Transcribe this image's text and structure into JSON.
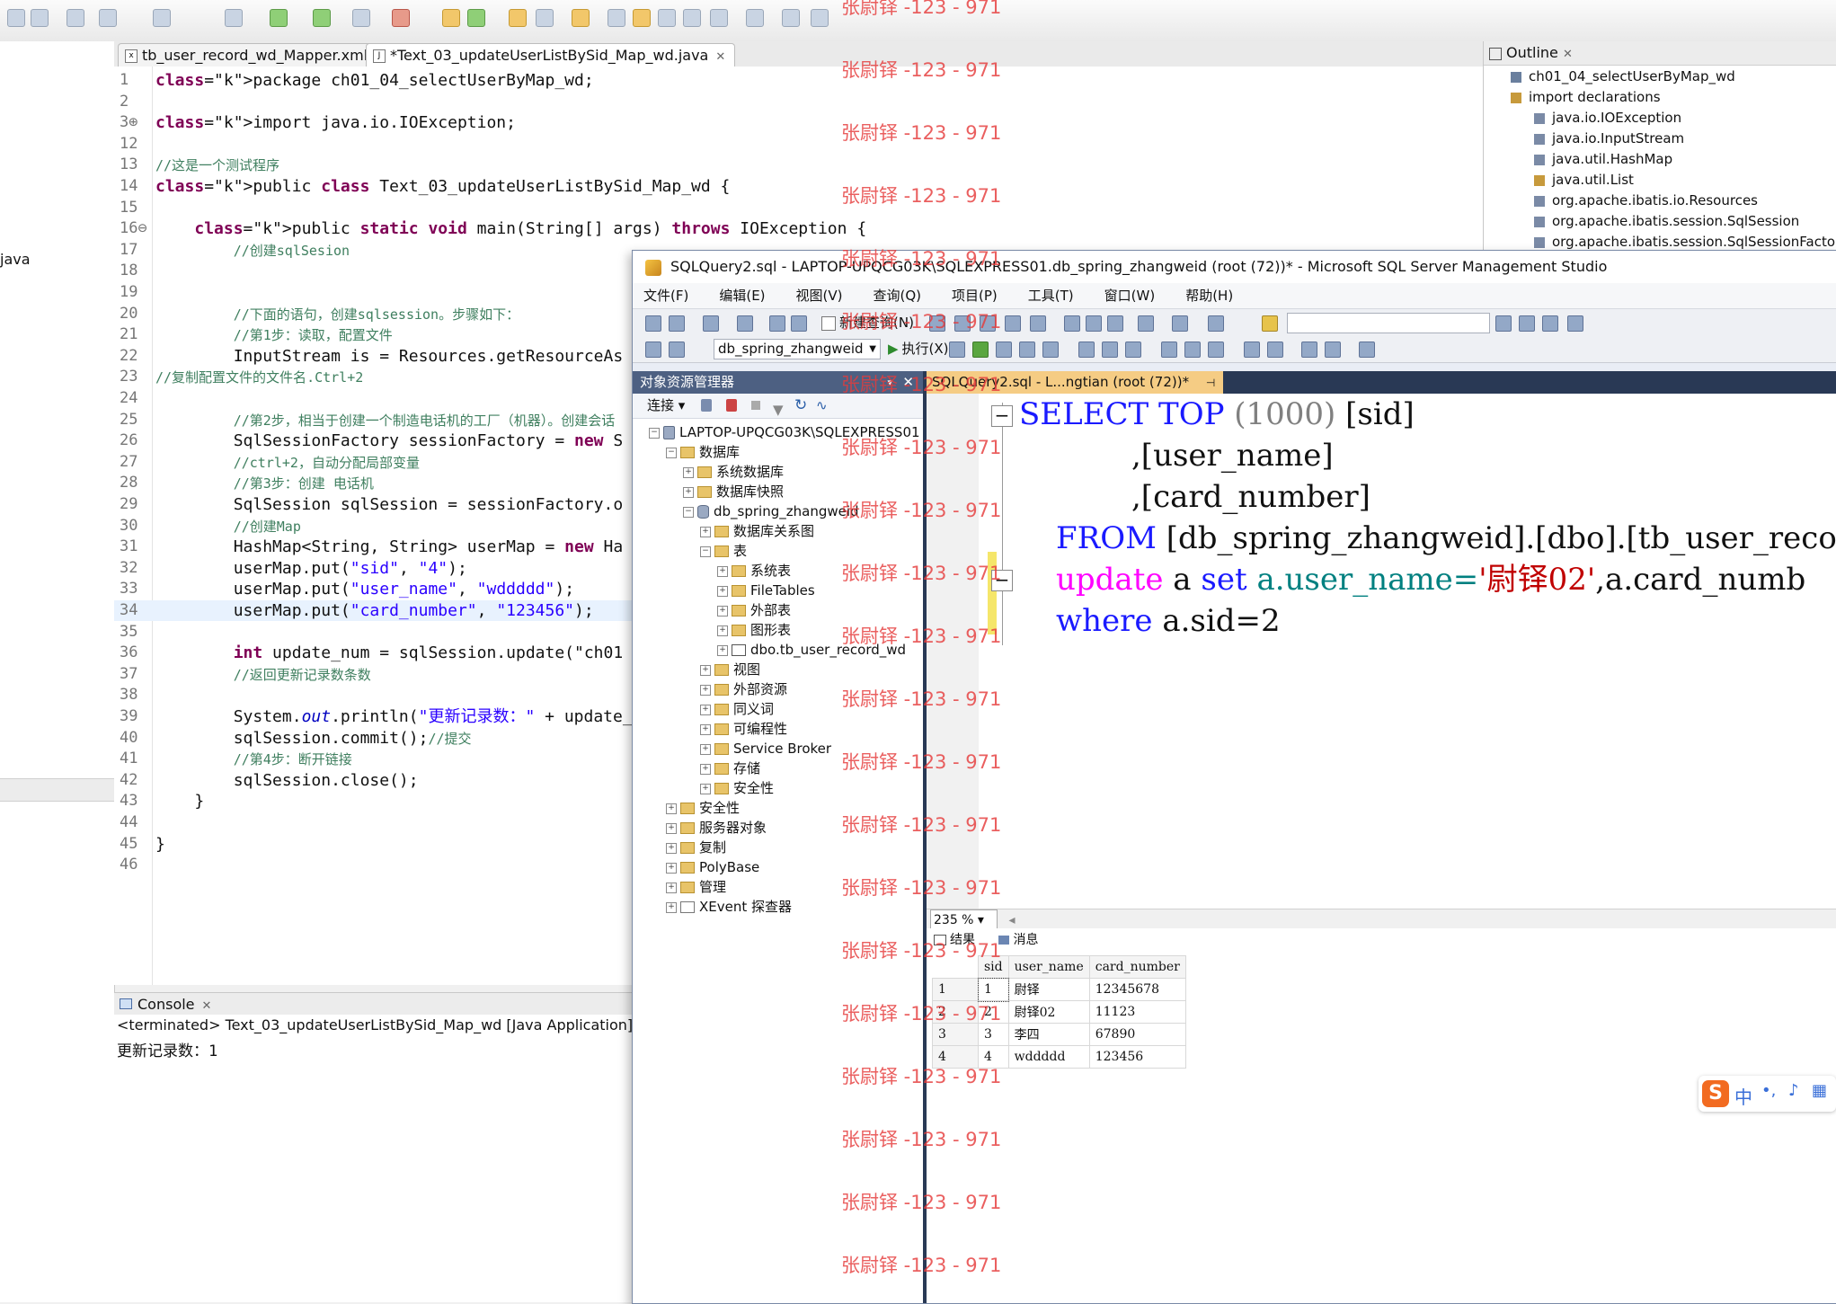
{
  "editor_tabs": [
    {
      "label": "tb_user_record_wd_Mapper.xml",
      "icon": "xml-file-icon"
    },
    {
      "label": "*Text_03_updateUserListBySid_Map_wd.java",
      "icon": "java-file-icon",
      "active": true
    }
  ],
  "left_partial_label": "java",
  "code_lines": [
    {
      "n": "1",
      "t": "package ch01_04_selectUserByMap_wd;"
    },
    {
      "n": "2",
      "t": ""
    },
    {
      "n": "3⊕",
      "t": "import java.io.IOException;"
    },
    {
      "n": "12",
      "t": ""
    },
    {
      "n": "13",
      "t": "//这是一个测试程序"
    },
    {
      "n": "14",
      "t": "public class Text_03_updateUserListBySid_Map_wd {"
    },
    {
      "n": "15",
      "t": ""
    },
    {
      "n": "16⊖",
      "t": "    public static void main(String[] args) throws IOException {"
    },
    {
      "n": "17",
      "t": "        //创建sqlSesion"
    },
    {
      "n": "18",
      "t": ""
    },
    {
      "n": "19",
      "t": ""
    },
    {
      "n": "20",
      "t": "        //下面的语句，创建sqlsession。步骤如下："
    },
    {
      "n": "21",
      "t": "        //第1步：读取，配置文件"
    },
    {
      "n": "22",
      "t": "        InputStream is = Resources.getResourceAs"
    },
    {
      "n": "23",
      "t": "//复制配置文件的文件名.Ctrl+2"
    },
    {
      "n": "24",
      "t": ""
    },
    {
      "n": "25",
      "t": "        //第2步，相当于创建一个制造电话机的工厂（机器）。创建会话"
    },
    {
      "n": "26",
      "t": "        SqlSessionFactory sessionFactory = new S"
    },
    {
      "n": "27",
      "t": "        //ctrl+2，自动分配局部变量"
    },
    {
      "n": "28",
      "t": "        //第3步：创建 电话机"
    },
    {
      "n": "29",
      "t": "        SqlSession sqlSession = sessionFactory.o"
    },
    {
      "n": "30",
      "t": "        //创建Map"
    },
    {
      "n": "31",
      "t": "        HashMap<String, String> userMap = new Ha"
    },
    {
      "n": "32",
      "t": "        userMap.put(\"sid\", \"4\");"
    },
    {
      "n": "33",
      "t": "        userMap.put(\"user_name\", \"wddddd\");"
    },
    {
      "n": "34",
      "t": "        userMap.put(\"card_number\", \"123456\");"
    },
    {
      "n": "35",
      "t": ""
    },
    {
      "n": "36",
      "t": "        int update_num = sqlSession.update(\"ch01"
    },
    {
      "n": "37",
      "t": "        //返回更新记录数条数"
    },
    {
      "n": "38",
      "t": ""
    },
    {
      "n": "39",
      "t": "        System.out.println(\"更新记录数：\" + update_n"
    },
    {
      "n": "40",
      "t": "        sqlSession.commit();//提交"
    },
    {
      "n": "41",
      "t": "        //第4步：断开链接"
    },
    {
      "n": "42",
      "t": "        sqlSession.close();"
    },
    {
      "n": "43",
      "t": "    }"
    },
    {
      "n": "44",
      "t": ""
    },
    {
      "n": "45",
      "t": "}"
    },
    {
      "n": "46",
      "t": ""
    }
  ],
  "console": {
    "tab_label": "Console",
    "terminated": "<terminated> Text_03_updateUserListBySid_Map_wd [Java Application] C:\\Prog",
    "output": "更新记录数：1"
  },
  "outline": {
    "tab_label": "Outline",
    "items": [
      "ch01_04_selectUserByMap_wd",
      "import declarations",
      "java.io.IOException",
      "java.io.InputStream",
      "java.util.HashMap",
      "java.util.List",
      "org.apache.ibatis.io.Resources",
      "org.apache.ibatis.session.SqlSession",
      "org.apache.ibatis.session.SqlSessionFactor"
    ]
  },
  "ssms": {
    "title": "SQLQuery2.sql - LAPTOP-UPQCG03K\\SQLEXPRESS01.db_spring_zhangweid (root (72))* - Microsoft SQL Server Management Studio",
    "menu": [
      "文件(F)",
      "编辑(E)",
      "视图(V)",
      "查询(Q)",
      "项目(P)",
      "工具(T)",
      "窗口(W)",
      "帮助(H)"
    ],
    "new_query_label": "新建查询(N)",
    "database_combo": "db_spring_zhangweid",
    "execute_label": "执行(X)",
    "object_explorer": {
      "title": "对象资源管理器",
      "connect_label": "连接",
      "tree": [
        {
          "d": 0,
          "pm": "−",
          "k": "srv",
          "t": "LAPTOP-UPQCG03K\\SQLEXPRESS01"
        },
        {
          "d": 1,
          "pm": "−",
          "k": "fd",
          "t": "数据库"
        },
        {
          "d": 2,
          "pm": "+",
          "k": "fd",
          "t": "系统数据库"
        },
        {
          "d": 2,
          "pm": "+",
          "k": "fd",
          "t": "数据库快照"
        },
        {
          "d": 2,
          "pm": "−",
          "k": "db",
          "t": "db_spring_zhangweid"
        },
        {
          "d": 3,
          "pm": "+",
          "k": "fd",
          "t": "数据库关系图"
        },
        {
          "d": 3,
          "pm": "−",
          "k": "fd",
          "t": "表"
        },
        {
          "d": 4,
          "pm": "+",
          "k": "fd",
          "t": "系统表"
        },
        {
          "d": 4,
          "pm": "+",
          "k": "fd",
          "t": "FileTables"
        },
        {
          "d": 4,
          "pm": "+",
          "k": "fd",
          "t": "外部表"
        },
        {
          "d": 4,
          "pm": "+",
          "k": "fd",
          "t": "图形表"
        },
        {
          "d": 4,
          "pm": "+",
          "k": "tbl",
          "t": "dbo.tb_user_record_wd"
        },
        {
          "d": 3,
          "pm": "+",
          "k": "fd",
          "t": "视图"
        },
        {
          "d": 3,
          "pm": "+",
          "k": "fd",
          "t": "外部资源"
        },
        {
          "d": 3,
          "pm": "+",
          "k": "fd",
          "t": "同义词"
        },
        {
          "d": 3,
          "pm": "+",
          "k": "fd",
          "t": "可编程性"
        },
        {
          "d": 3,
          "pm": "+",
          "k": "fd",
          "t": "Service Broker"
        },
        {
          "d": 3,
          "pm": "+",
          "k": "fd",
          "t": "存储"
        },
        {
          "d": 3,
          "pm": "+",
          "k": "fd",
          "t": "安全性"
        },
        {
          "d": 1,
          "pm": "+",
          "k": "fd",
          "t": "安全性"
        },
        {
          "d": 1,
          "pm": "+",
          "k": "fd",
          "t": "服务器对象"
        },
        {
          "d": 1,
          "pm": "+",
          "k": "fd",
          "t": "复制"
        },
        {
          "d": 1,
          "pm": "+",
          "k": "fd",
          "t": "PolyBase"
        },
        {
          "d": 1,
          "pm": "+",
          "k": "fd",
          "t": "管理"
        },
        {
          "d": 1,
          "pm": "+",
          "k": "xe",
          "t": "XEvent 探查器"
        }
      ]
    },
    "query_tab": "SQLQuery2.sql - L...ngtian (root (72))*",
    "sql": {
      "l1a": "SELECT",
      "l1b": "TOP",
      "l1c": "(1000)",
      "l1d": "[sid]",
      "l2": ",[user_name]",
      "l3": ",[card_number]",
      "l4a": "FROM",
      "l4b": "[db_spring_zhangweid].[dbo].[tb_user_reco",
      "l5a": "update",
      "l5b": "a",
      "l5c": "set",
      "l5d": "a.user_name=",
      "l5e": "'尉铎02'",
      "l5f": ",a.card_numb",
      "l6a": "where",
      "l6b": "a.sid=2"
    },
    "zoom": "235 %",
    "results_tab": "结果",
    "messages_tab": "消息",
    "grid": {
      "columns": [
        "sid",
        "user_name",
        "card_number"
      ],
      "rows": [
        [
          "1",
          "1",
          "尉铎",
          "12345678"
        ],
        [
          "2",
          "2",
          "尉铎02",
          "11123"
        ],
        [
          "3",
          "3",
          "李四",
          "67890"
        ],
        [
          "4",
          "4",
          "wddddd",
          "123456"
        ]
      ]
    }
  },
  "watermark": "张尉铎 -123 - 971",
  "ime_label": "中"
}
